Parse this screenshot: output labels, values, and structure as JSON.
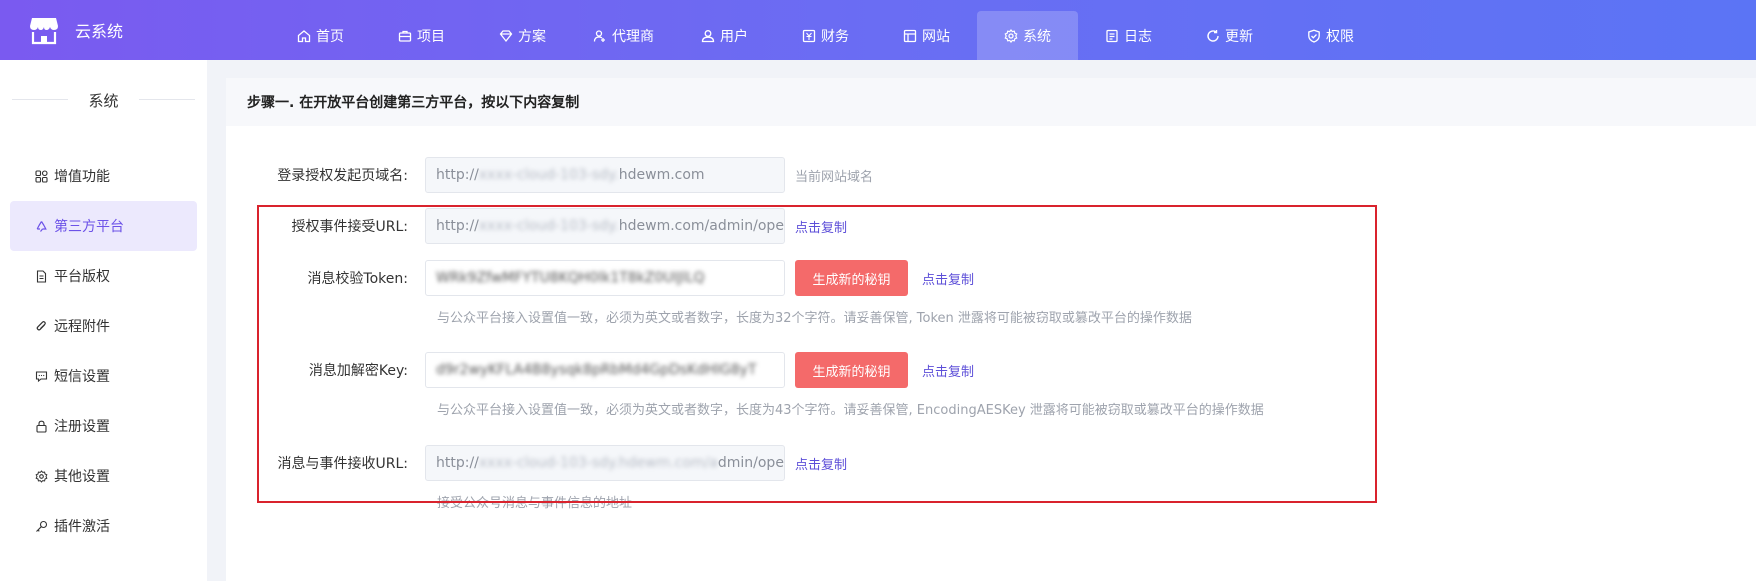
{
  "app": {
    "title": "云系统"
  },
  "nav": [
    {
      "label": "首页",
      "icon": "home-icon"
    },
    {
      "label": "项目",
      "icon": "briefcase-icon"
    },
    {
      "label": "方案",
      "icon": "diamond-icon"
    },
    {
      "label": "代理商",
      "icon": "agent-icon"
    },
    {
      "label": "用户",
      "icon": "user-icon"
    },
    {
      "label": "财务",
      "icon": "finance-icon"
    },
    {
      "label": "网站",
      "icon": "website-icon"
    },
    {
      "label": "系统",
      "icon": "gear-icon",
      "active": true
    },
    {
      "label": "日志",
      "icon": "log-icon"
    },
    {
      "label": "更新",
      "icon": "refresh-icon"
    },
    {
      "label": "权限",
      "icon": "shield-icon"
    }
  ],
  "sidebar": {
    "title": "系统",
    "items": [
      {
        "label": "增值功能",
        "icon": "grid-icon"
      },
      {
        "label": "第三方平台",
        "icon": "recycle-icon",
        "active": true
      },
      {
        "label": "平台版权",
        "icon": "document-icon"
      },
      {
        "label": "远程附件",
        "icon": "paperclip-icon"
      },
      {
        "label": "短信设置",
        "icon": "message-icon"
      },
      {
        "label": "注册设置",
        "icon": "lock-icon"
      },
      {
        "label": "其他设置",
        "icon": "settings-icon"
      },
      {
        "label": "插件激活",
        "icon": "key-icon"
      }
    ]
  },
  "step": {
    "title": "步骤一. 在开放平台创建第三方平台，按以下内容复制"
  },
  "form": {
    "domain": {
      "label": "登录授权发起页域名:",
      "value_visible": "http://",
      "value_tail": "hdewm.com",
      "hint": "当前网站域名"
    },
    "auth_url": {
      "label": "授权事件接受URL:",
      "value_visible": "http://",
      "value_tail": "hdewm.com/admin/openNotif",
      "copy": "点击复制"
    },
    "token": {
      "label": "消息校验Token:",
      "generate": "生成新的秘钥",
      "copy": "点击复制",
      "help": "与公众平台接入设置值一致，必须为英文或者数字，长度为32个字符。请妥善保管, Token 泄露将可能被窃取或篡改平台的操作数据"
    },
    "aes_key": {
      "label": "消息加解密Key:",
      "generate": "生成新的秘钥",
      "copy": "点击复制",
      "help": "与公众平台接入设置值一致，必须为英文或者数字，长度为43个字符。请妥善保管, EncodingAESKey 泄露将可能被窃取或篡改平台的操作数据"
    },
    "msg_url": {
      "label": "消息与事件接收URL:",
      "value_visible": "http://",
      "value_tail": "dmin/openNotif",
      "copy": "点击复制",
      "help": "接受公众号消息与事件信息的地址"
    }
  },
  "colors": {
    "accent": "#6c52e8",
    "danger_button": "#f46a6a",
    "highlight_border": "#d9232d",
    "link": "#5c4ed8"
  }
}
